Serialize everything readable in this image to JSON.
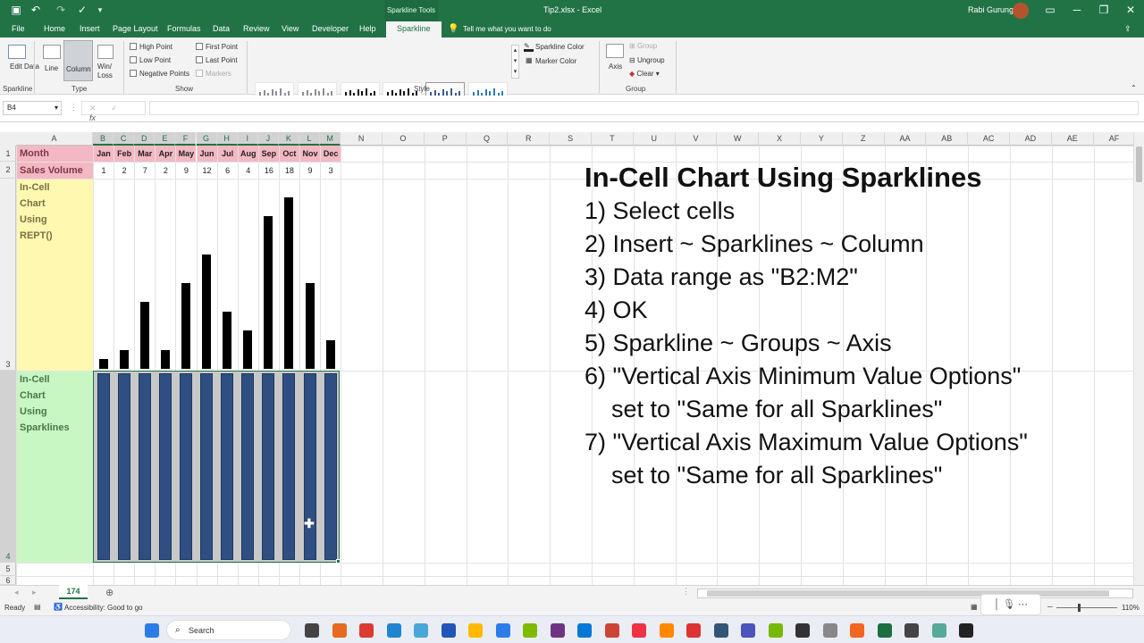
{
  "window": {
    "title": "Tip2.xlsx - Excel",
    "user": "Rabi Gurung",
    "context_tab": "Sparkline Tools"
  },
  "tabs": [
    "File",
    "Home",
    "Insert",
    "Page Layout",
    "Formulas",
    "Data",
    "Review",
    "View",
    "Developer",
    "Help",
    "Sparkline"
  ],
  "active_tab": "Sparkline",
  "tell_me": "Tell me what you want to do",
  "ribbon": {
    "edit_data": "Edit Data",
    "group_sparkline": "Sparkline",
    "type_buttons": [
      "Line",
      "Column",
      "Win/ Loss"
    ],
    "group_type": "Type",
    "show_checks": [
      "High Point",
      "Low Point",
      "Negative Points",
      "First Point",
      "Last Point",
      "Markers"
    ],
    "group_show": "Show",
    "group_style": "Style",
    "sparkline_color": "Sparkline Color",
    "marker_color": "Marker Color",
    "axis": "Axis",
    "group_btn": "Group",
    "ungroup": "Ungroup",
    "clear": "Clear",
    "group_group": "Group"
  },
  "name_box": "B4",
  "columns": [
    "A",
    "B",
    "C",
    "D",
    "E",
    "F",
    "G",
    "H",
    "I",
    "J",
    "K",
    "L",
    "M",
    "N",
    "O",
    "P",
    "Q",
    "R",
    "S",
    "T",
    "U",
    "V",
    "W",
    "X",
    "Y",
    "Z",
    "AA",
    "AB",
    "AC",
    "AD",
    "AE",
    "AF"
  ],
  "rows": [
    "1",
    "2",
    "3",
    "4",
    "5",
    "6"
  ],
  "sheet": {
    "a1": "Month",
    "a2": "Sales Volume",
    "a3": "In-Cell Chart Using REPT()",
    "a4": "In-Cell Chart Using Sparklines",
    "months": [
      "Jan",
      "Feb",
      "Mar",
      "Apr",
      "May",
      "Jun",
      "Jul",
      "Aug",
      "Sep",
      "Oct",
      "Nov",
      "Dec"
    ],
    "sales": [
      1,
      2,
      7,
      2,
      9,
      12,
      6,
      4,
      16,
      18,
      9,
      3
    ]
  },
  "chart_data": {
    "type": "bar",
    "categories": [
      "Jan",
      "Feb",
      "Mar",
      "Apr",
      "May",
      "Jun",
      "Jul",
      "Aug",
      "Sep",
      "Oct",
      "Nov",
      "Dec"
    ],
    "values": [
      1,
      2,
      7,
      2,
      9,
      12,
      6,
      4,
      16,
      18,
      9,
      3
    ],
    "ylim": [
      0,
      18
    ]
  },
  "steps": {
    "heading": "In-Cell Chart Using Sparklines",
    "lines": [
      "1) Select cells",
      "2) Insert ~ Sparklines ~ Column",
      "3) Data range as \"B2:M2\"",
      "4) OK",
      "5) Sparkline ~ Groups ~ Axis",
      "6) \"Vertical Axis Minimum Value Options\"",
      "    set to \"Same for all Sparklines\"",
      "7) \"Vertical Axis Maximum Value Options\"",
      "    set to \"Same for all Sparklines\""
    ]
  },
  "sheet_tab": "174",
  "status": {
    "ready": "Ready",
    "accessibility": "Accessibility: Good to go",
    "zoom": "110%"
  },
  "taskbar": {
    "search": "Search"
  },
  "colors": {
    "excel_green": "#217346",
    "sparkline_fill": "#2f4f82",
    "month_fill": "#f4b8c3",
    "rept_fill": "#fff8b0",
    "spark_fill": "#c9f7c4"
  }
}
